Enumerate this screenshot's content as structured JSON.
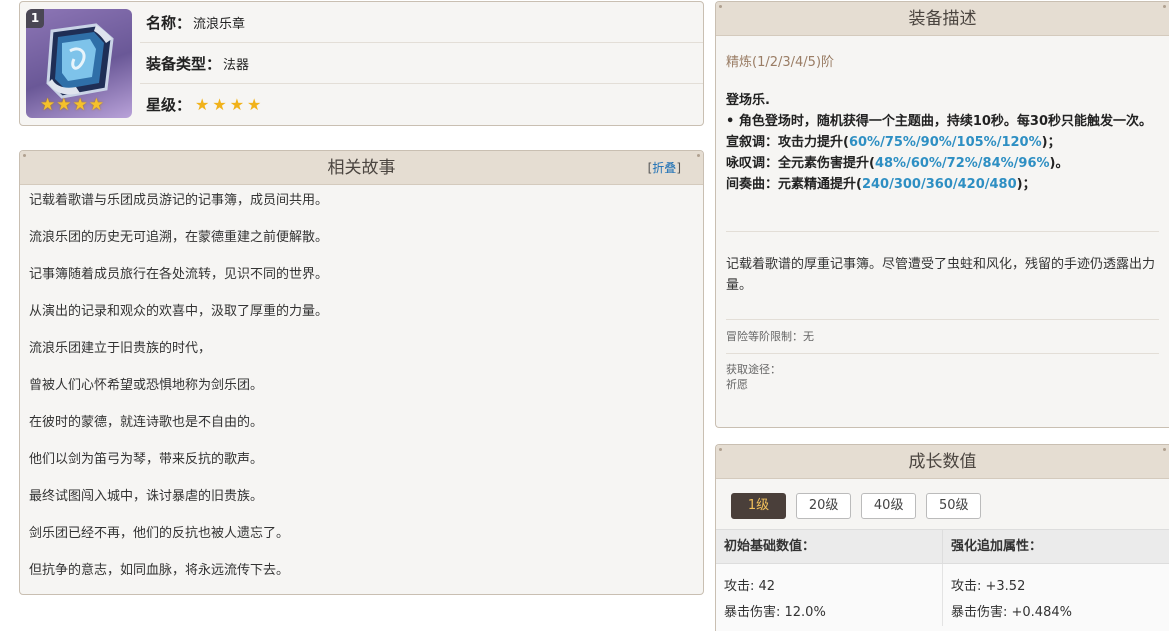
{
  "item": {
    "rank_badge": "1",
    "icon_stars": "★★★★",
    "name_label": "名称：",
    "name_value": "流浪乐章",
    "type_label": "装备类型：",
    "type_value": "法器",
    "rarity_label": "星级：",
    "rarity_stars": "★★★★",
    "rarity_count": 4
  },
  "story": {
    "title": "相关故事",
    "toggle_open": "[",
    "toggle_label": "折叠",
    "toggle_close": "]",
    "lines": [
      "记载着歌谱与乐团成员游记的记事簿，成员间共用。",
      "流浪乐团的历史无可追溯，在蒙德重建之前便解散。",
      "记事簿随着成员旅行在各处流转，见识不同的世界。",
      "从演出的记录和观众的欢喜中，汲取了厚重的力量。",
      "流浪乐团建立于旧贵族的时代，",
      "曾被人们心怀希望或恐惧地称为剑乐团。",
      "在彼时的蒙德，就连诗歌也是不自由的。",
      "他们以剑为笛弓为琴，带来反抗的歌声。",
      "最终试图闯入城中，诛讨暴虐的旧贵族。",
      "剑乐团已经不再，他们的反抗也被人遗忘了。",
      "但抗争的意志，如同血脉，将永远流传下去。"
    ]
  },
  "description": {
    "title": "装备描述",
    "refinement": "精炼(1/2/3/4/5)阶",
    "effect_title": "登场乐.",
    "effect_line1": "• 角色登场时，随机获得一个主题曲，持续10秒。每30秒只能触发一次。",
    "recit_label": "宣叙调：攻击力提升(",
    "recit_values": "60%/75%/90%/105%/120%",
    "recit_end": ")；",
    "aria_label": "咏叹调：全元素伤害提升(",
    "aria_values": "48%/60%/72%/84%/96%",
    "aria_end": ")。",
    "inter_label": "间奏曲：元素精通提升(",
    "inter_values": "240/300/360/420/480",
    "inter_end": ")；",
    "lore": "记载着歌谱的厚重记事簿。尽管遭受了虫蛀和风化，残留的手迹仍透露出力量。",
    "adventure_limit": "冒险等阶限制：无",
    "source_label": "获取途径：",
    "source_value": "祈愿"
  },
  "growth": {
    "title": "成长数值",
    "levels": [
      "1级",
      "20级",
      "40级",
      "50级"
    ],
    "active_level": "1级",
    "base_header": "初始基础数值：",
    "bonus_header": "强化追加属性：",
    "base_atk": "攻击: 42",
    "base_crit": "暴击伤害: 12.0%",
    "bonus_atk": "攻击: +3.52",
    "bonus_crit": "暴击伤害: +0.484%"
  },
  "colors": {
    "accent_blue": "#2e8fc3",
    "header_bg": "#e5ddd2",
    "refine_brown": "#9a7d65",
    "star_gold": "#f1b21a",
    "active_level_bg": "#4a3f3a"
  }
}
